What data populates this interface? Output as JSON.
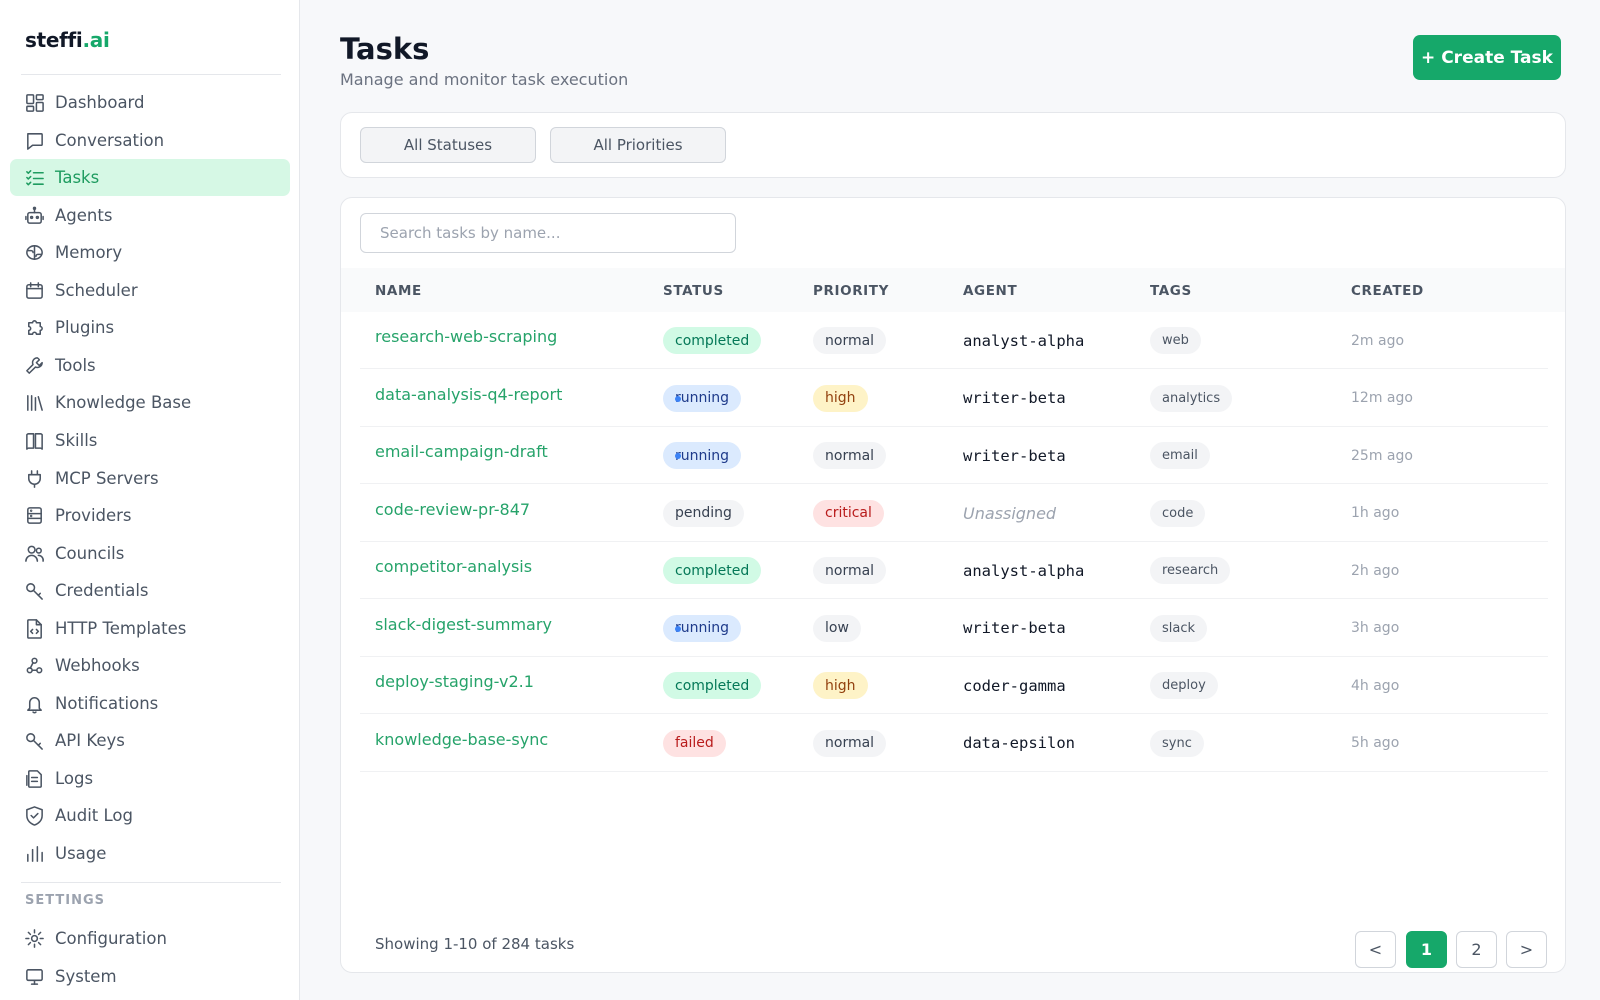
{
  "app": {
    "logo_main": "steffi",
    "logo_accent": ".ai"
  },
  "sidebar": {
    "items": [
      {
        "label": "Dashboard",
        "icon": "dashboard-icon"
      },
      {
        "label": "Conversation",
        "icon": "chat-icon"
      },
      {
        "label": "Tasks",
        "icon": "tasks-icon",
        "active": true
      },
      {
        "label": "Agents",
        "icon": "robot-icon"
      },
      {
        "label": "Memory",
        "icon": "brain-icon"
      },
      {
        "label": "Scheduler",
        "icon": "calendar-icon"
      },
      {
        "label": "Plugins",
        "icon": "puzzle-icon"
      },
      {
        "label": "Tools",
        "icon": "wrench-icon"
      },
      {
        "label": "Knowledge Base",
        "icon": "library-icon"
      },
      {
        "label": "Skills",
        "icon": "book-icon"
      },
      {
        "label": "MCP Servers",
        "icon": "plug-icon"
      },
      {
        "label": "Providers",
        "icon": "server-icon"
      },
      {
        "label": "Councils",
        "icon": "users-icon"
      },
      {
        "label": "Credentials",
        "icon": "key-icon"
      },
      {
        "label": "HTTP Templates",
        "icon": "file-code-icon"
      },
      {
        "label": "Webhooks",
        "icon": "webhook-icon"
      },
      {
        "label": "Notifications",
        "icon": "bell-icon"
      },
      {
        "label": "API Keys",
        "icon": "key-icon"
      },
      {
        "label": "Logs",
        "icon": "logs-icon"
      },
      {
        "label": "Audit Log",
        "icon": "shield-icon"
      },
      {
        "label": "Usage",
        "icon": "bar-chart-icon"
      }
    ],
    "settings_heading": "SETTINGS",
    "settings_items": [
      {
        "label": "Configuration",
        "icon": "gear-icon"
      },
      {
        "label": "System",
        "icon": "monitor-icon"
      }
    ]
  },
  "header": {
    "title": "Tasks",
    "subtitle": "Manage and monitor task execution",
    "create_label": "+ Create Task"
  },
  "filters": {
    "status_label": "All Statuses",
    "priority_label": "All Priorities"
  },
  "search": {
    "placeholder": "Search tasks by name..."
  },
  "table": {
    "columns": [
      "NAME",
      "STATUS",
      "PRIORITY",
      "AGENT",
      "TAGS",
      "CREATED"
    ],
    "rows": [
      {
        "name": "research-web-scraping",
        "status": "completed",
        "priority": "normal",
        "agent": "analyst-alpha",
        "tag": "web",
        "created": "2m ago"
      },
      {
        "name": "data-analysis-q4-report",
        "status": "running",
        "priority": "high",
        "agent": "writer-beta",
        "tag": "analytics",
        "created": "12m ago"
      },
      {
        "name": "email-campaign-draft",
        "status": "running",
        "priority": "normal",
        "agent": "writer-beta",
        "tag": "email",
        "created": "25m ago"
      },
      {
        "name": "code-review-pr-847",
        "status": "pending",
        "priority": "critical",
        "agent": "Unassigned",
        "agent_unassigned": true,
        "tag": "code",
        "created": "1h ago"
      },
      {
        "name": "competitor-analysis",
        "status": "completed",
        "priority": "normal",
        "agent": "analyst-alpha",
        "tag": "research",
        "created": "2h ago"
      },
      {
        "name": "slack-digest-summary",
        "status": "running",
        "priority": "low",
        "agent": "writer-beta",
        "tag": "slack",
        "created": "3h ago"
      },
      {
        "name": "deploy-staging-v2.1",
        "status": "completed",
        "priority": "high",
        "agent": "coder-gamma",
        "tag": "deploy",
        "created": "4h ago"
      },
      {
        "name": "knowledge-base-sync",
        "status": "failed",
        "priority": "normal",
        "agent": "data-epsilon",
        "tag": "sync",
        "created": "5h ago"
      }
    ]
  },
  "pagination": {
    "summary": "Showing 1-10 of 284 tasks",
    "prev": "<",
    "pages": [
      "1",
      "2"
    ],
    "current": "1",
    "next": ">"
  },
  "colors": {
    "accent": "#16a86a",
    "active_nav_bg": "#d6f8e5"
  }
}
